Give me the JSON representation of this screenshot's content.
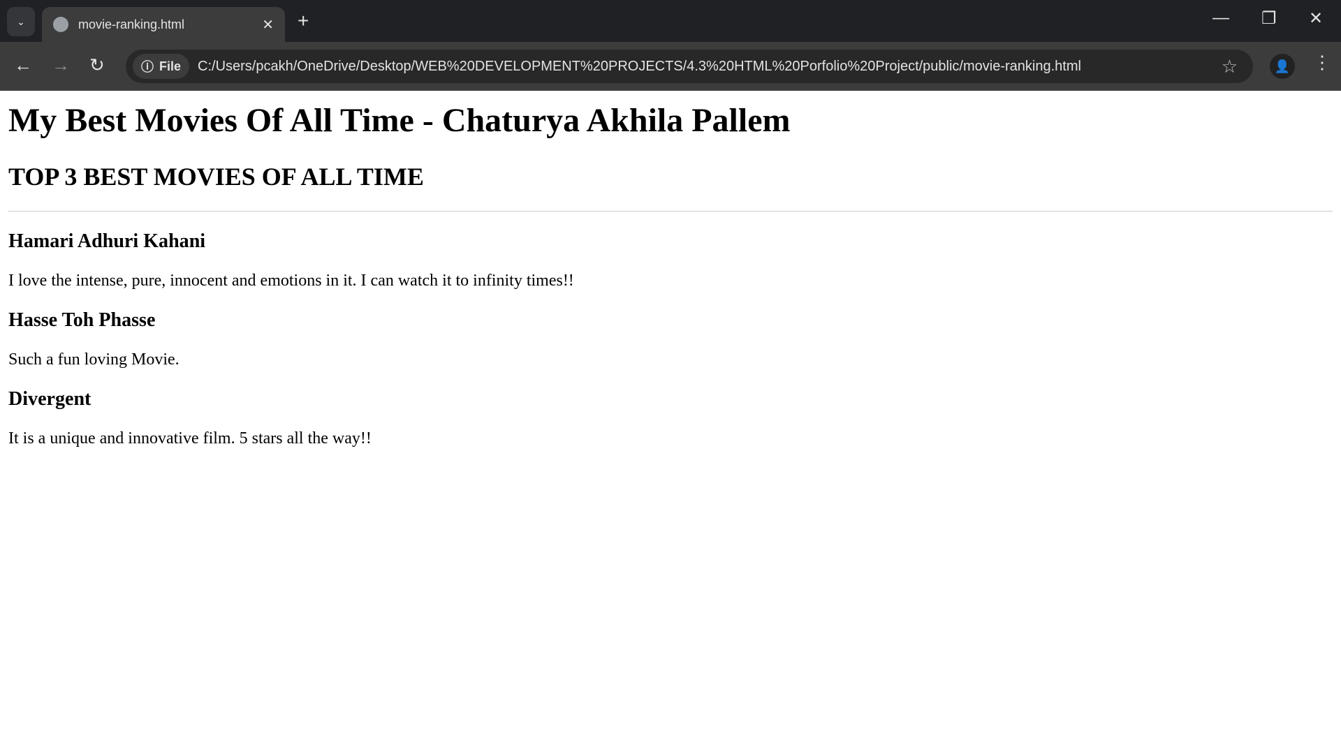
{
  "browser": {
    "tab_title": "movie-ranking.html",
    "site_chip": "File",
    "url": "C:/Users/pcakh/OneDrive/Desktop/WEB%20DEVELOPMENT%20PROJECTS/4.3%20HTML%20Porfolio%20Project/public/movie-ranking.html"
  },
  "page": {
    "title": "My Best Movies Of All Time - Chaturya Akhila Pallem",
    "subtitle": "TOP 3 BEST MOVIES OF ALL TIME",
    "movies": [
      {
        "name": "Hamari Adhuri Kahani",
        "review": "I love the intense, pure, innocent and emotions in it. I can watch it to infinity times!!"
      },
      {
        "name": "Hasse Toh Phasse",
        "review": "Such a fun loving Movie."
      },
      {
        "name": "Divergent",
        "review": "It is a unique and innovative film. 5 stars all the way!!"
      }
    ]
  }
}
